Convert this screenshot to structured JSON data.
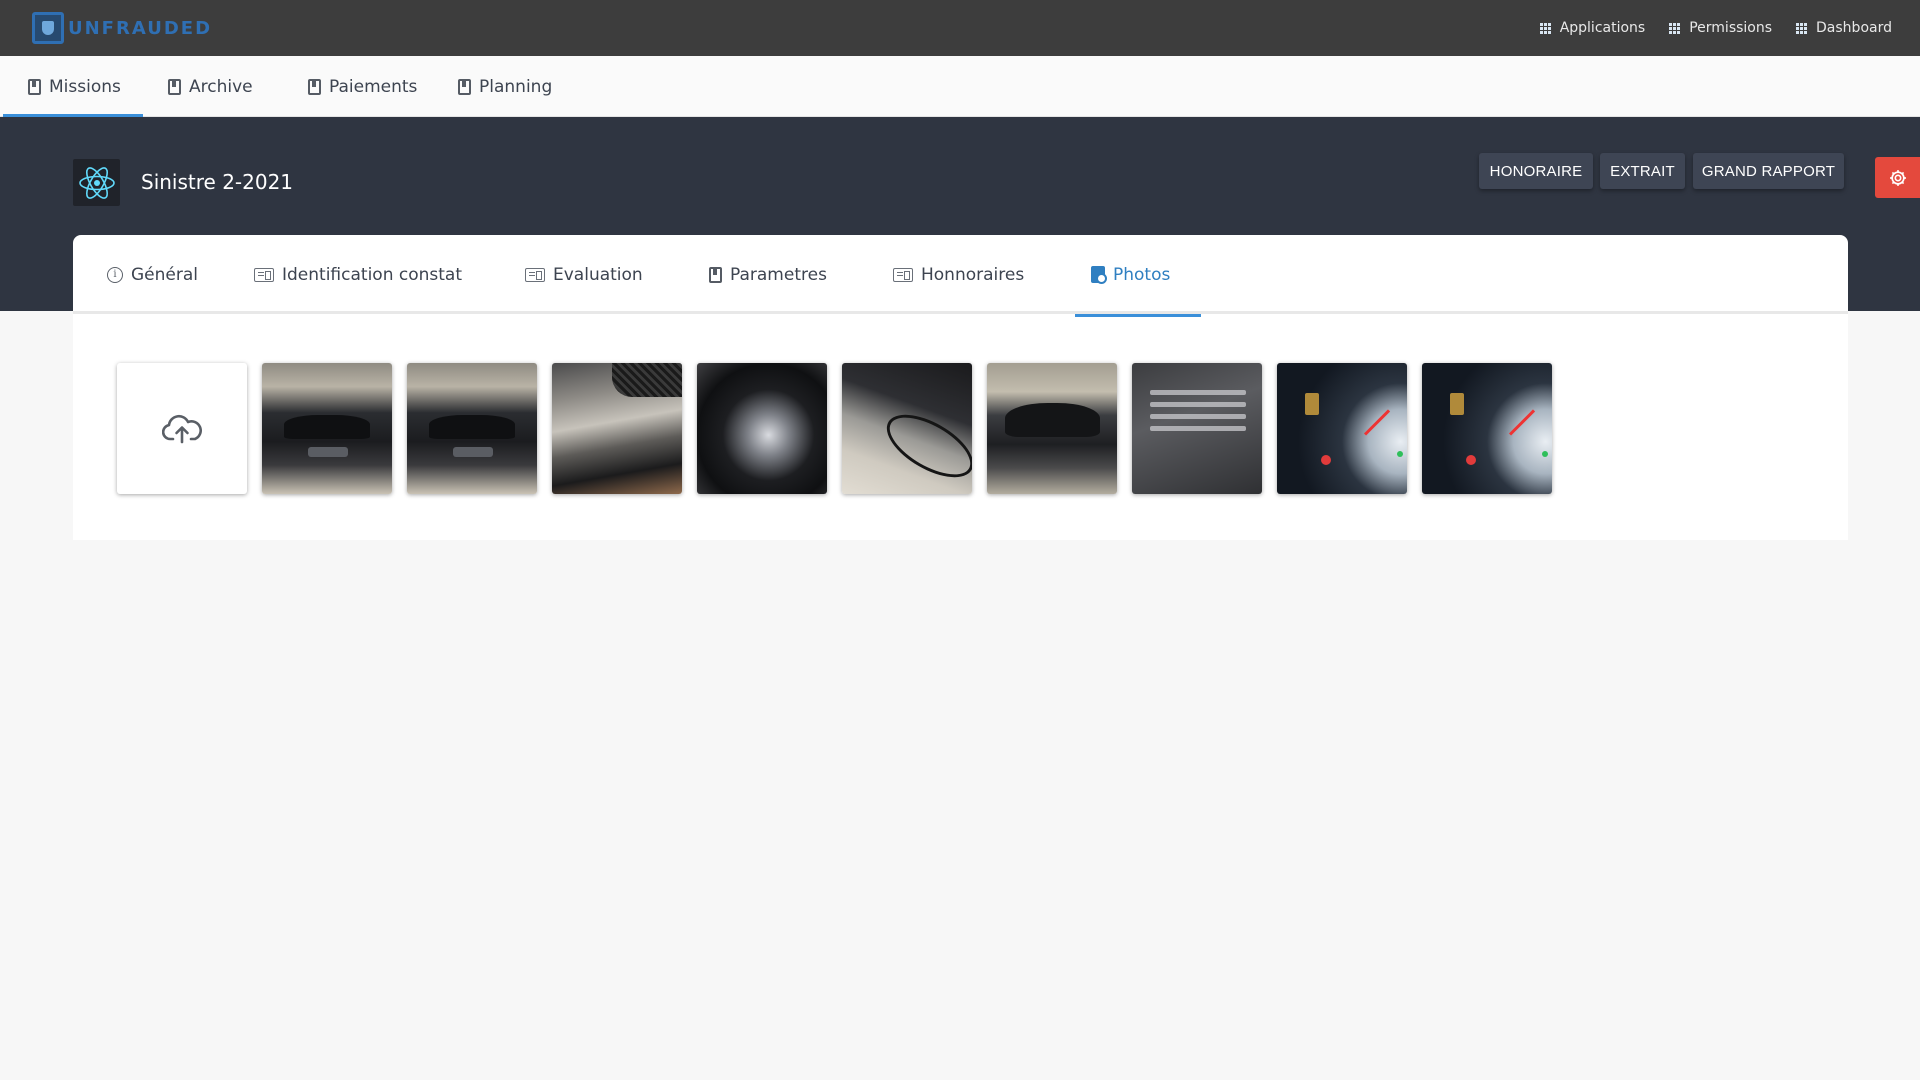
{
  "app": {
    "brand": "UNFRAUDED"
  },
  "topnav": {
    "items": [
      {
        "label": "Applications",
        "icon": "grid-icon"
      },
      {
        "label": "Permissions",
        "icon": "grid-icon"
      },
      {
        "label": "Dashboard",
        "icon": "grid-icon"
      }
    ]
  },
  "modules": {
    "active": "Missions",
    "items": [
      {
        "label": "Missions",
        "icon": "document-icon"
      },
      {
        "label": "Archive",
        "icon": "document-icon"
      },
      {
        "label": "Paiements",
        "icon": "document-icon"
      },
      {
        "label": "Planning",
        "icon": "document-icon"
      }
    ]
  },
  "entity": {
    "title": "Sinistre 2-2021",
    "icon": "react-atom-icon"
  },
  "actions": {
    "honoraire": "HONORAIRE",
    "extrait": "EXTRAIT",
    "grand_rapport": "GRAND RAPPORT",
    "settings_icon": "gear-icon"
  },
  "tabs": {
    "active": "Photos",
    "items": [
      {
        "label": "Général",
        "icon": "info-icon"
      },
      {
        "label": "Identification constat",
        "icon": "card-icon"
      },
      {
        "label": "Evaluation",
        "icon": "card-icon"
      },
      {
        "label": "Parametres",
        "icon": "document-icon"
      },
      {
        "label": "Honnoraires",
        "icon": "card-icon"
      },
      {
        "label": "Photos",
        "icon": "photo-file-icon"
      }
    ]
  },
  "gallery": {
    "upload_icon": "cloud-upload-icon",
    "photo_count": 9,
    "plate_text": [
      "Marque : KIA",
      "Type: AAW6FC5F",
      "Ch: KNAHU81GBE704807",
      "PTAC: 2180 Kgs"
    ]
  },
  "colors": {
    "topbar": "#3d3d3d",
    "hero": "#2f3541",
    "accent": "#3a8fd9",
    "active_tab_text": "#2f7fc1",
    "settings_button": "#e4493d",
    "brand": "#2f6fb3"
  }
}
